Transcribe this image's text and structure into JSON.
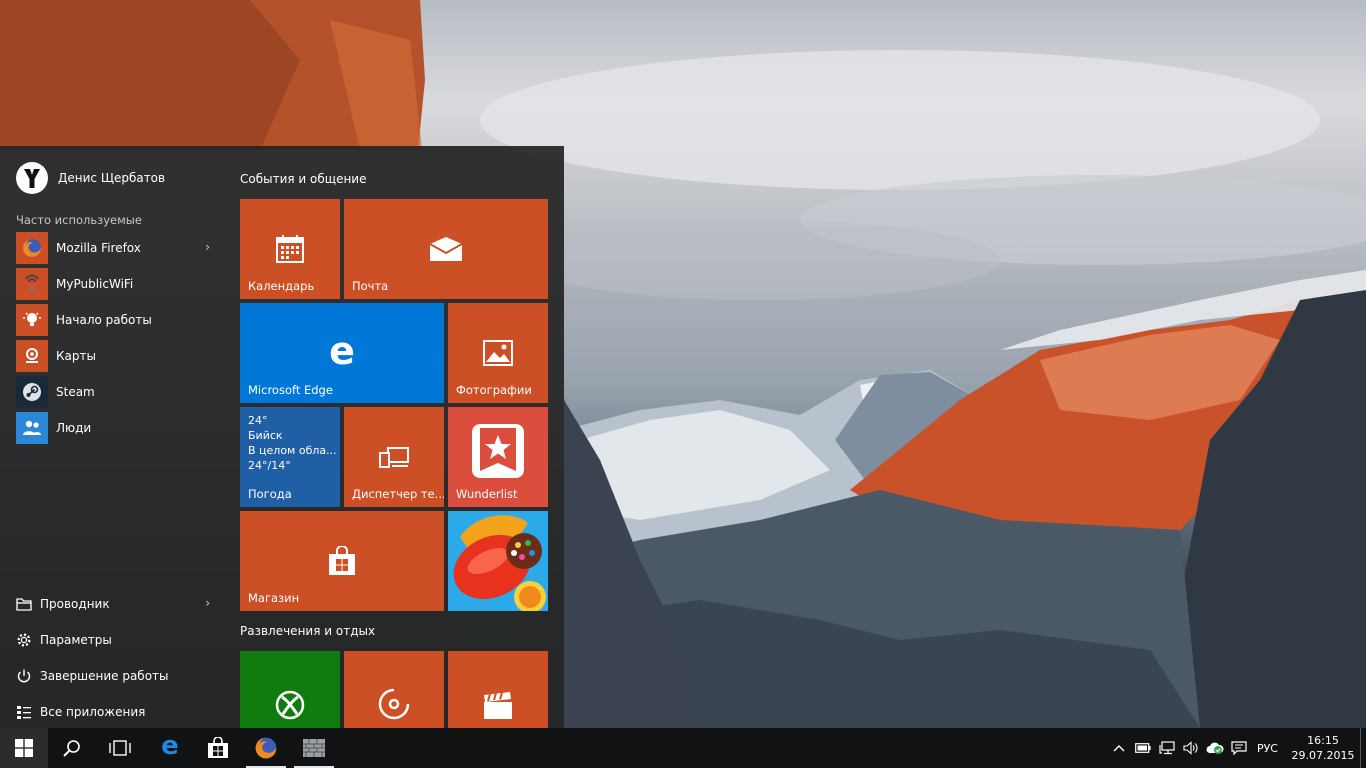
{
  "user": {
    "name": "Денис Щербатов"
  },
  "frequent": {
    "label": "Часто используемые",
    "items": [
      {
        "label": "Mozilla Firefox",
        "icon": "firefox-icon",
        "has_submenu": true
      },
      {
        "label": "MyPublicWiFi",
        "icon": "wifi-hotspot-icon"
      },
      {
        "label": "Начало работы",
        "icon": "lightbulb-icon"
      },
      {
        "label": "Карты",
        "icon": "maps-icon"
      },
      {
        "label": "Steam",
        "icon": "steam-icon"
      },
      {
        "label": "Люди",
        "icon": "people-icon"
      }
    ]
  },
  "system": {
    "items": [
      {
        "label": "Проводник",
        "icon": "file-explorer-icon",
        "has_submenu": true
      },
      {
        "label": "Параметры",
        "icon": "gear-icon"
      },
      {
        "label": "Завершение работы",
        "icon": "power-icon"
      },
      {
        "label": "Все приложения",
        "icon": "all-apps-icon"
      }
    ]
  },
  "groups": {
    "events": "События и общение",
    "entertainment": "Развлечения и отдых"
  },
  "tiles": {
    "calendar": "Календарь",
    "mail": "Почта",
    "edge": "Microsoft Edge",
    "photos": "Фотографии",
    "weather": {
      "temp": "24°",
      "city": "Бийск",
      "condition": "В целом обла...",
      "range": "24°/14°",
      "label": "Погода"
    },
    "device_manager": "Диспетчер те...",
    "wunderlist": "Wunderlist",
    "store": "Магазин"
  },
  "taskbar": {
    "language": "РУС",
    "time": "16:15",
    "date": "29.07.2015"
  },
  "colors": {
    "accent_orange": "#cd4f26",
    "edge_blue": "#0178d7",
    "weather_blue": "#1f5fa6",
    "wunderlist_red": "#db4e3d",
    "xbox_green": "#107c10"
  }
}
